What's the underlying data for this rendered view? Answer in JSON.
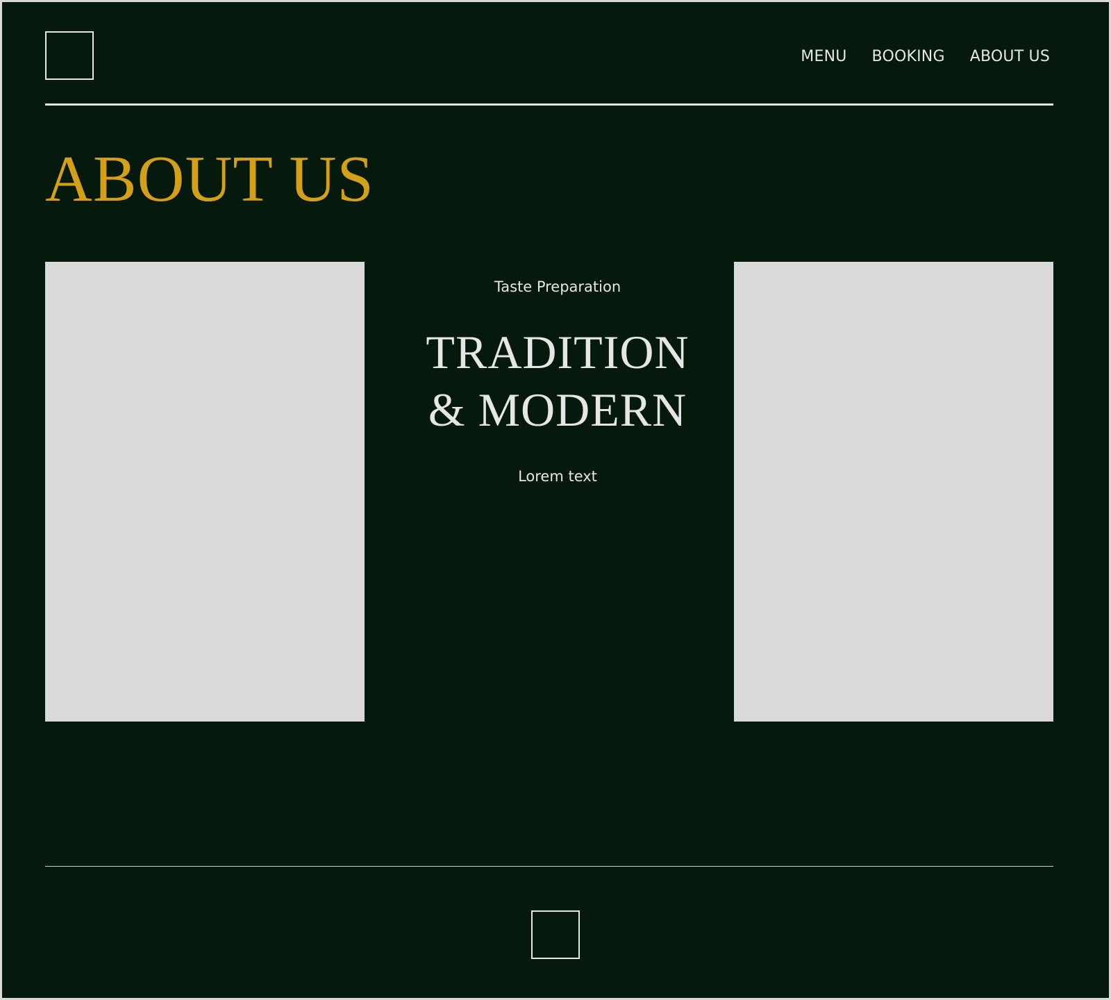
{
  "header": {
    "logo": "logo-placeholder",
    "nav": [
      {
        "label": "MENU"
      },
      {
        "label": "BOOKING"
      },
      {
        "label": "ABOUT US"
      }
    ]
  },
  "page": {
    "title": "ABOUT US"
  },
  "feature": {
    "eyebrow": "Taste Preparation",
    "headline_line1": "TRADITION",
    "headline_line2": "& MODERN",
    "body": "Lorem text"
  },
  "footer": {
    "logo": "logo-placeholder"
  },
  "colors": {
    "background": "#051a0d",
    "accent": "#d4a017",
    "text": "#e6e6e6",
    "placeholder": "#d9d9d9"
  }
}
